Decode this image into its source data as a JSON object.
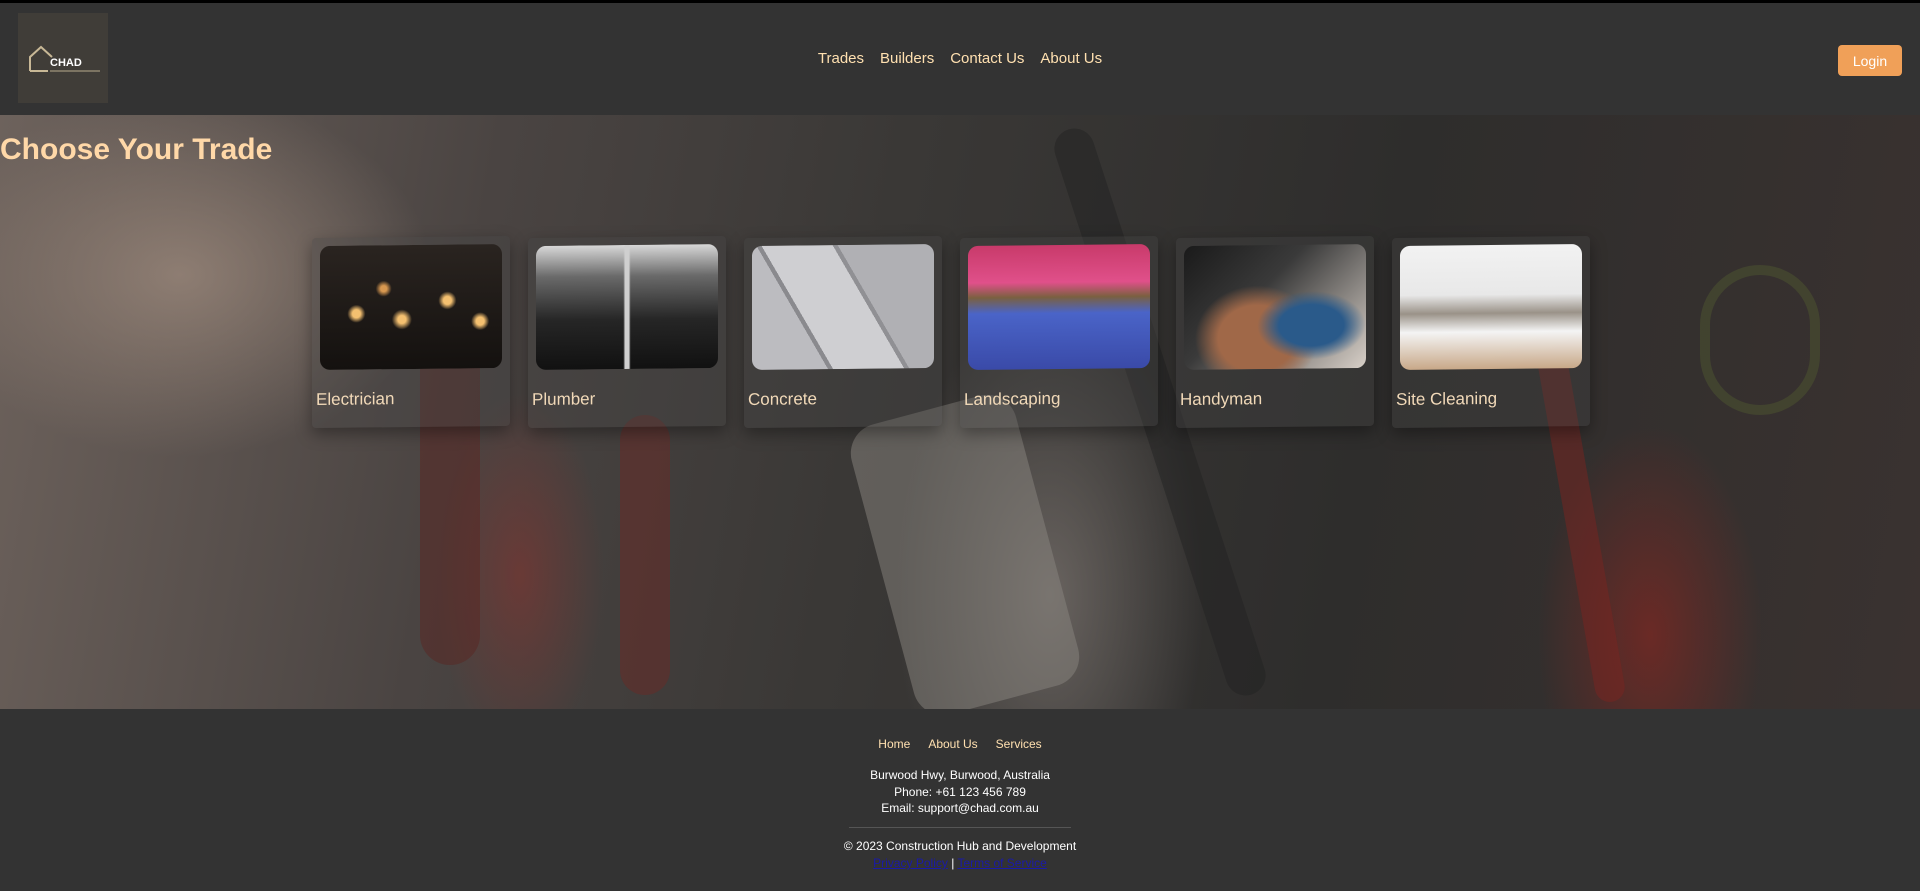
{
  "header": {
    "logo_text": "CHAD",
    "nav": [
      "Trades",
      "Builders",
      "Contact Us",
      "About Us"
    ],
    "login_label": "Login"
  },
  "hero": {
    "title": "Choose Your Trade",
    "trades": [
      {
        "label": "Electrician",
        "icon": "electrician-photo"
      },
      {
        "label": "Plumber",
        "icon": "plumber-photo"
      },
      {
        "label": "Concrete",
        "icon": "concrete-photo"
      },
      {
        "label": "Landscaping",
        "icon": "landscaping-photo"
      },
      {
        "label": "Handyman",
        "icon": "handyman-photo"
      },
      {
        "label": "Site Cleaning",
        "icon": "site-cleaning-photo"
      }
    ]
  },
  "footer": {
    "nav": [
      "Home",
      "About Us",
      "Services"
    ],
    "address": "Burwood Hwy, Burwood, Australia",
    "phone": "Phone: +61 123 456 789",
    "email": "Email: support@chad.com.au",
    "copyright": "© 2023 Construction Hub and Development",
    "privacy": "Privacy Policy",
    "separator": "|",
    "terms": "Terms of Service"
  },
  "colors": {
    "accent": "#f0a058",
    "nav_text": "#ffe0b0",
    "title": "#ffd8a8",
    "background": "#333333"
  }
}
